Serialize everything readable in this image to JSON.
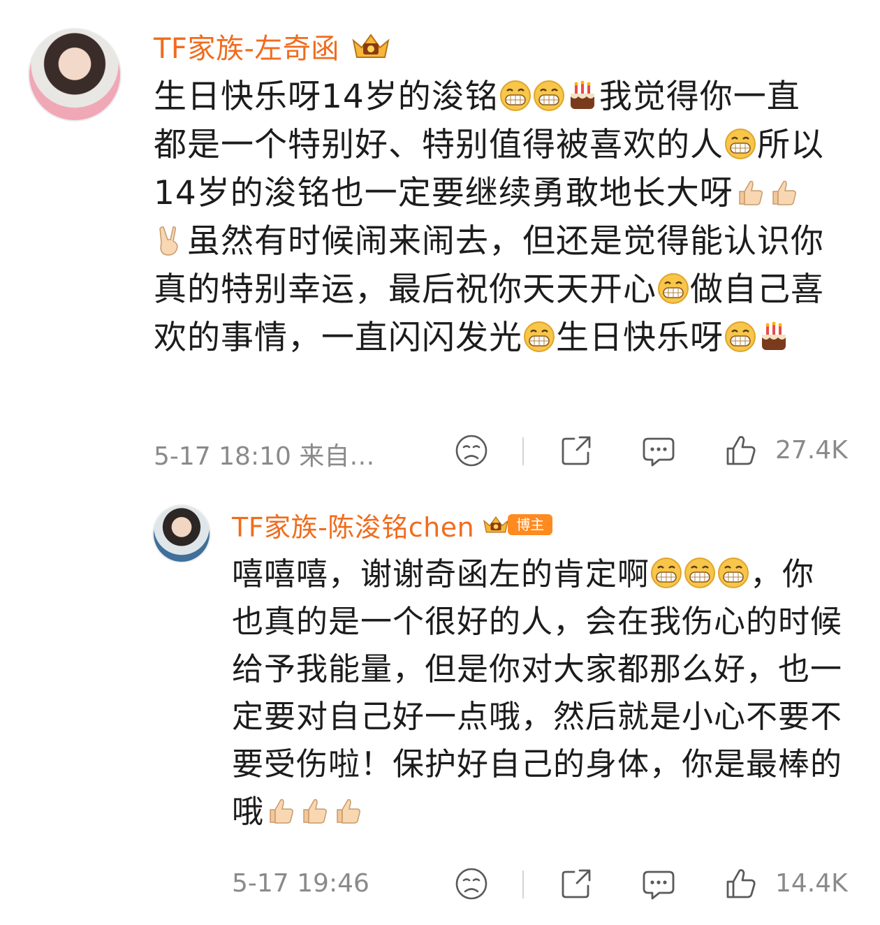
{
  "comments": [
    {
      "author": "TF家族-左奇函",
      "segments": [
        {
          "t": "生日快乐呀14岁的浚铭"
        },
        {
          "e": "grin"
        },
        {
          "e": "grin"
        },
        {
          "e": "cake"
        },
        {
          "t": "我觉得你一直都是一个特别好、特别值得被喜欢的人"
        },
        {
          "e": "grin"
        },
        {
          "t": "所以14岁的浚铭也一定要继续勇敢地长大呀"
        },
        {
          "e": "thumbs"
        },
        {
          "e": "thumbs"
        },
        {
          "e": "victory"
        },
        {
          "t": "虽然有时候闹来闹去，但还是觉得能认识你真的特别幸运，最后祝你天天开心"
        },
        {
          "e": "grin"
        },
        {
          "t": "做自己喜欢的事情，一直闪闪发光"
        },
        {
          "e": "grin"
        },
        {
          "t": "生日快乐呀"
        },
        {
          "e": "grin"
        },
        {
          "e": "cake"
        }
      ],
      "time": "5-17 18:10 来自…",
      "likes": "27.4K"
    },
    {
      "author": "TF家族-陈浚铭chen",
      "badge": "博主",
      "segments": [
        {
          "t": "嘻嘻嘻，谢谢奇函左的肯定啊"
        },
        {
          "e": "grin"
        },
        {
          "e": "grin"
        },
        {
          "e": "grin"
        },
        {
          "t": "，你也真的是一个很好的人，会在我伤心的时候给予我能量，但是你对大家都那么好，也一定要对自己好一点哦，然后就是小心不要不要受伤啦！保护好自己的身体，你是最棒的哦"
        },
        {
          "e": "thumbs"
        },
        {
          "e": "thumbs"
        },
        {
          "e": "thumbs"
        }
      ],
      "time": "5-17 19:46",
      "likes": "14.4K"
    }
  ],
  "icons": {
    "react": "sad-face-icon",
    "share": "share-icon",
    "reply": "comment-icon",
    "like": "thumbs-up-icon",
    "crown": "crown-badge-icon"
  },
  "colors": {
    "name": "#f06c1e",
    "badge": "#ff8a1f",
    "meta": "#8a8a8a"
  }
}
